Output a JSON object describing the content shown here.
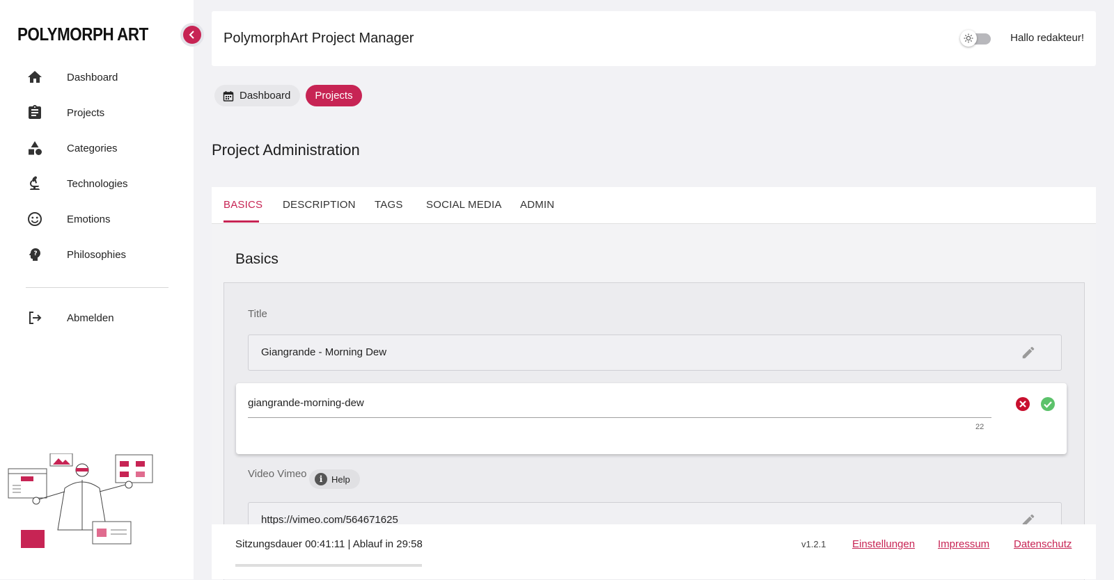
{
  "brand": "POLYMORPH ART",
  "sidebar": {
    "items": [
      {
        "label": "Dashboard",
        "icon": "home-icon"
      },
      {
        "label": "Projects",
        "icon": "clipboard-icon"
      },
      {
        "label": "Categories",
        "icon": "shapes-icon"
      },
      {
        "label": "Technologies",
        "icon": "microscope-icon"
      },
      {
        "label": "Emotions",
        "icon": "smiley-icon"
      },
      {
        "label": "Philosophies",
        "icon": "psychology-icon"
      }
    ],
    "logout": {
      "label": "Abmelden",
      "icon": "logout-icon"
    }
  },
  "header": {
    "title": "PolymorphArt Project Manager",
    "greeting": "Hallo redakteur!",
    "theme_toggle": "off"
  },
  "breadcrumb": {
    "dashboard": "Dashboard",
    "projects": "Projects"
  },
  "page": {
    "title": "Project Administration"
  },
  "tabs": [
    "BASICS",
    "DESCRIPTION",
    "TAGS",
    "SOCIAL MEDIA",
    "ADMIN"
  ],
  "active_tab": "BASICS",
  "section": {
    "title": "Basics",
    "title_field": {
      "label": "Title",
      "value": "Giangrande - Morning Dew"
    },
    "slug_field": {
      "value": "giangrande-morning-dew",
      "count": "22"
    },
    "video_field": {
      "label": "Video Vimeo",
      "help": "Help",
      "value": "https://vimeo.com/564671625"
    }
  },
  "footer": {
    "session": "Sitzungsdauer 00:41:11 | Ablauf in 29:58",
    "version": "v1.2.1",
    "links": [
      "Einstellungen",
      "Impressum",
      "Datenschutz"
    ]
  },
  "colors": {
    "accent": "#c72454",
    "confirm": "#5cc26b",
    "cancel": "#c8102e",
    "background": "#f2f2f5"
  }
}
